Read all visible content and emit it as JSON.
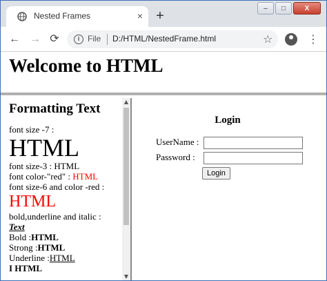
{
  "browser": {
    "tab_title": "Nested Frames",
    "tab_close": "×",
    "new_tab": "+",
    "window_controls": {
      "minimize": "–",
      "maximize": "□",
      "close": "X"
    },
    "nav": {
      "back": "←",
      "forward": "→",
      "reload": "⟳"
    },
    "address": {
      "scheme_label": "File",
      "url": "D:/HTML/NestedFrame.html"
    },
    "icons": [
      "globe-icon",
      "info-icon",
      "star-icon",
      "profile-icon",
      "menu-icon"
    ]
  },
  "top_frame": {
    "heading": "Welcome to HTML"
  },
  "left_frame": {
    "heading": "Formatting Text",
    "lines": {
      "font_size_7_label": "font size -7 :",
      "font_size_7_sample": "HTML",
      "font_size_3_label": "font size-3 : HTML",
      "font_color_label": "font color-\"red\" : ",
      "font_color_sample": "HTML",
      "font_size_6_label": "font size-6 and color -red :",
      "font_size_6_sample": "HTML",
      "biu_label": "bold,underline and italic :",
      "biu_sample": "Text",
      "bold_label": "Bold :",
      "bold_sample": "HTML",
      "strong_label": "Strong :",
      "strong_sample": "HTML",
      "underline_label": "Underline :",
      "underline_sample": "HTML",
      "partial": "I    HTML"
    },
    "scrollbar": {
      "up": "▲",
      "down": "▼"
    }
  },
  "right_frame": {
    "title": "Login",
    "username_label": "UserName :",
    "username_value": "",
    "password_label": "Password :",
    "password_value": "",
    "login_button": "Login"
  },
  "colors": {
    "accent_red": "#ff0000",
    "frame_border": "#8a8a8a"
  }
}
